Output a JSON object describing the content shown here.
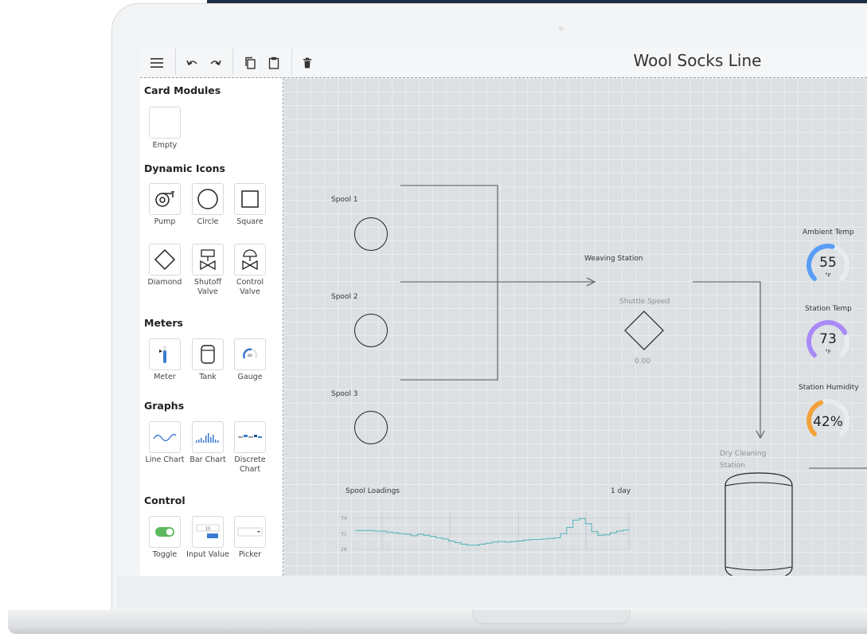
{
  "app": {
    "title": "Wool Socks Line"
  },
  "toolbar": {
    "menu_icon": "hamburger-menu-icon",
    "undo_icon": "undo-icon",
    "redo_icon": "redo-icon",
    "copy_icon": "copy-icon",
    "paste_icon": "paste-icon",
    "delete_icon": "trash-icon"
  },
  "sidebar": {
    "card_modules": {
      "heading": "Card Modules",
      "items": [
        {
          "label": "Empty"
        }
      ]
    },
    "dynamic_icons": {
      "heading": "Dynamic Icons",
      "items": [
        {
          "label": "Pump"
        },
        {
          "label": "Circle"
        },
        {
          "label": "Square"
        },
        {
          "label": "Diamond"
        },
        {
          "label": "Shutoff Valve"
        },
        {
          "label": "Control Valve"
        }
      ]
    },
    "meters": {
      "heading": "Meters",
      "items": [
        {
          "label": "Meter"
        },
        {
          "label": "Tank"
        },
        {
          "label": "Gauge"
        }
      ],
      "gauge_text": "60"
    },
    "graphs": {
      "heading": "Graphs",
      "items": [
        {
          "label": "Line Chart"
        },
        {
          "label": "Bar Chart"
        },
        {
          "label": "Discrete Chart"
        }
      ]
    },
    "control": {
      "heading": "Control",
      "items": [
        {
          "label": "Toggle"
        },
        {
          "label": "Input Value"
        },
        {
          "label": "Picker"
        }
      ],
      "input_text": "10"
    }
  },
  "canvas": {
    "spools": [
      {
        "label": "Spool 1"
      },
      {
        "label": "Spool 2"
      },
      {
        "label": "Spool 3"
      }
    ],
    "weaving_station": {
      "label": "Weaving Station",
      "metric_label": "Shuttle Speed",
      "metric_value": "0.00"
    },
    "dry_cleaning": {
      "label": "Dry Cleaning Station"
    },
    "gauges": [
      {
        "label": "Ambient Temp",
        "value": "55",
        "unit": "°F",
        "color": "#5a9df5",
        "level": 0.55
      },
      {
        "label": "Station Temp",
        "value": "73",
        "unit": "°F",
        "color": "#a88af7",
        "level": 0.73
      },
      {
        "label": "Station Humidity",
        "value": "42%",
        "unit": "",
        "color": "#f2a23c",
        "level": 0.42
      }
    ],
    "chart": {
      "title": "Spool Loadings",
      "range_label": "1 day"
    }
  },
  "chart_data": {
    "type": "line",
    "title": "Spool Loadings",
    "range": "1 day",
    "yticks": [
      "34",
      "31",
      "28"
    ],
    "ylim": [
      28,
      35
    ],
    "series": [
      {
        "color": "#4fb3b8",
        "values": [
          31.6,
          31.6,
          31.6,
          31.5,
          31.5,
          31.3,
          31.2,
          31.0,
          30.9,
          30.6,
          30.9,
          30.7,
          30.5,
          30.2,
          30.0,
          29.6,
          29.3,
          29.0,
          28.8,
          28.8,
          29.0,
          29.2,
          29.4,
          29.5,
          29.4,
          29.5,
          29.6,
          29.8,
          29.9,
          29.9,
          30.0,
          30.1,
          30.2,
          31.0,
          32.2,
          33.6,
          33.9,
          32.9,
          31.4,
          30.7,
          30.8,
          31.2,
          31.5,
          31.7,
          31.8
        ]
      }
    ]
  },
  "colors": {
    "canvas_bg": "#dce0e3",
    "accent_green": "#5cb85c",
    "accent_blue": "#3b7bd1",
    "line": "#6b6f73"
  }
}
